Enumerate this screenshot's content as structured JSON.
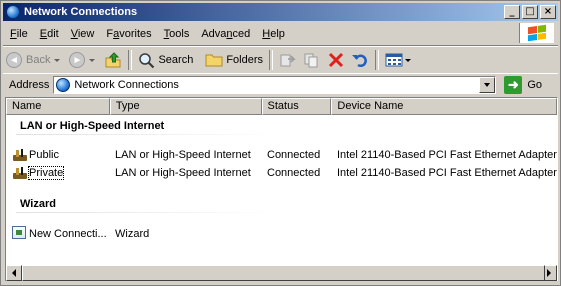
{
  "window": {
    "title": "Network Connections"
  },
  "title_buttons": {
    "minimize": "_",
    "maximize": "□",
    "close": "×"
  },
  "menu": [
    {
      "label": "File",
      "accel": "F",
      "rest": "ile"
    },
    {
      "label": "Edit",
      "accel": "E",
      "rest": "dit"
    },
    {
      "label": "View",
      "accel": "V",
      "rest": "iew"
    },
    {
      "label": "Favorites",
      "accel": "a",
      "pre": "F",
      "rest": "vorites"
    },
    {
      "label": "Tools",
      "accel": "T",
      "rest": "ools"
    },
    {
      "label": "Advanced",
      "accel": "n",
      "pre": "Adva",
      "rest": "ced"
    },
    {
      "label": "Help",
      "accel": "H",
      "rest": "elp"
    }
  ],
  "toolbar": {
    "back_label": "Back",
    "search_label": "Search",
    "folders_label": "Folders",
    "up_icon": "folder-up-icon",
    "views_icon": "views-icon"
  },
  "address": {
    "label": "Address",
    "value": "Network Connections",
    "go_label": "Go"
  },
  "columns": [
    "Name",
    "Type",
    "Status",
    "Device Name"
  ],
  "groups": [
    {
      "title": "LAN or High-Speed Internet",
      "items": [
        {
          "name": "Public",
          "type": "LAN or High-Speed Internet",
          "status": "Connected",
          "device": "Intel 21140-Based PCI Fast Ethernet Adapter"
        },
        {
          "name": "Private",
          "type": "LAN or High-Speed Internet",
          "status": "Connected",
          "device": "Intel 21140-Based PCI Fast Ethernet Adapter"
        }
      ]
    },
    {
      "title": "Wizard",
      "items": [
        {
          "name": "New Connecti...",
          "type": "Wizard",
          "status": "",
          "device": ""
        }
      ]
    }
  ],
  "colors": {
    "title_start": "#0a246a",
    "title_end": "#a6caf0",
    "chrome": "#d4d0c8"
  }
}
